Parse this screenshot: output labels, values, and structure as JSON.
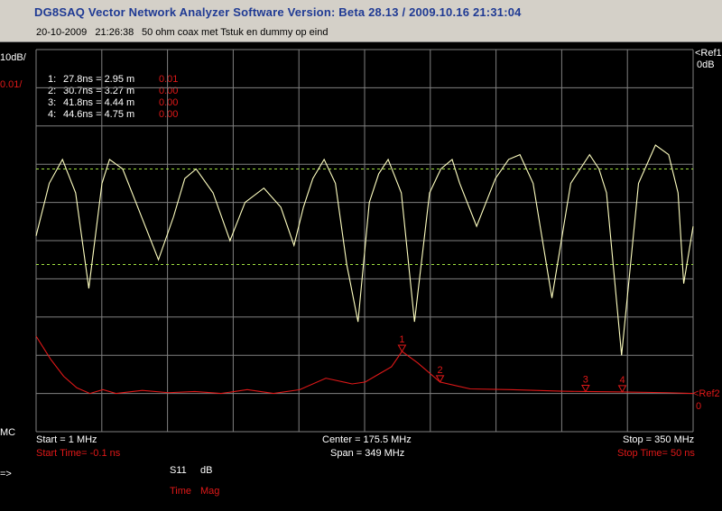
{
  "header": {
    "title": "DG8SAQ Vector Network Analyzer Software   Version:  Beta 28.13 / 2009.10.16 21:31:04",
    "timestamp": "20-10-2009   21:26:38",
    "description": "50 ohm coax met Tstuk en dummy op eind"
  },
  "left_scale": {
    "trace1": "10dB/",
    "trace2": "0.01/"
  },
  "right_scale": {
    "ref1": "<Ref1",
    "ref1_value": "0dB",
    "ref2": "<Ref2",
    "ref2_value": "0"
  },
  "bottom": {
    "start": "Start = 1 MHz",
    "start_time": "Start Time= -0.1 ns",
    "center": "Center = 175.5 MHz",
    "span": "Span = 349 MHz",
    "stop": "Stop = 350 MHz",
    "stop_time": "Stop Time= 50 ns",
    "mc": "MC",
    "arrow": "=>"
  },
  "legend": {
    "param": "S11",
    "unit": "dB",
    "domain": "Time",
    "format": "Mag"
  },
  "markers": [
    {
      "label": "1:",
      "x": "27.8ns = 2.95 m",
      "value": "0.01"
    },
    {
      "label": "2:",
      "x": "30.7ns = 3.27 m",
      "value": "0.00"
    },
    {
      "label": "3:",
      "x": "41.8ns = 4.44 m",
      "value": "0.00"
    },
    {
      "label": "4:",
      "x": "44.6ns = 4.75 m",
      "value": "0.00"
    }
  ],
  "colors": {
    "background": "#000000",
    "grid": "#808080",
    "trace_db": "#ffffc0",
    "trace_time": "#e01818",
    "limit": "#a0e040"
  },
  "chart_data": [
    {
      "type": "line",
      "name": "S11 dB",
      "xlim": [
        1,
        350
      ],
      "ylim": [
        -80,
        0
      ],
      "limit_lines": [
        -25,
        -45
      ],
      "x": [
        1,
        8,
        15,
        22,
        29,
        36,
        40,
        47,
        56,
        66,
        74,
        80,
        86,
        95,
        104,
        112,
        122,
        131,
        138,
        143,
        148,
        154,
        160,
        166,
        172,
        178,
        183,
        188,
        195,
        202,
        210,
        216,
        222,
        226,
        235,
        245,
        252,
        258,
        265,
        275,
        285,
        295,
        300,
        304,
        312,
        321,
        330,
        337,
        342,
        345,
        350
      ],
      "y": [
        -39,
        -28,
        -23,
        -30,
        -50,
        -28,
        -23,
        -25,
        -34,
        -44,
        -35,
        -27,
        -25,
        -30,
        -40,
        -32,
        -29,
        -33,
        -41,
        -33,
        -27,
        -23,
        -28,
        -45,
        -57,
        -32,
        -26,
        -23,
        -30,
        -57,
        -30,
        -25,
        -23,
        -28,
        -37,
        -27,
        -23,
        -22,
        -28,
        -52,
        -28,
        -22,
        -25,
        -30,
        -64,
        -28,
        -20,
        -22,
        -30,
        -49,
        -37
      ]
    },
    {
      "type": "line",
      "name": "Time Mag",
      "xlim": [
        -0.1,
        50
      ],
      "ylim": [
        0,
        0.015
      ],
      "x": [
        -0.1,
        1,
        2,
        3,
        4,
        5,
        6,
        8,
        10,
        12,
        14,
        16,
        18,
        20,
        22,
        24,
        25,
        26,
        27,
        27.8,
        29,
        30.7,
        33,
        36,
        40,
        41.8,
        44.6,
        48,
        50
      ],
      "y": [
        0.0015,
        0.0009,
        0.00045,
        0.00015,
        0.0,
        0.0001,
        0.0,
        8e-05,
        2e-05,
        5e-05,
        0.0,
        0.0001,
        0.0,
        0.0001,
        0.0004,
        0.00025,
        0.0003,
        0.0005,
        0.0007,
        0.0011,
        0.0008,
        0.0003,
        0.00012,
        0.0001,
        6e-05,
        5e-05,
        4e-05,
        2e-05,
        0.0
      ],
      "markers_x": [
        27.8,
        30.7,
        41.8,
        44.6
      ]
    }
  ]
}
